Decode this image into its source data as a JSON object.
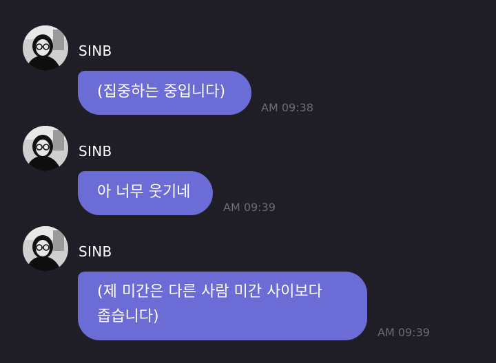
{
  "messages": [
    {
      "sender": "SINB",
      "text": "(집중하는 중입니다)",
      "time": "AM 09:38"
    },
    {
      "sender": "SINB",
      "text": "아 너무 웃기네",
      "time": "AM 09:39"
    },
    {
      "sender": "SINB",
      "text_line1": "(제 미간은 다른 사람 미간 사이보다",
      "text_line2": "좁습니다)",
      "time": "AM 09:39"
    }
  ],
  "colors": {
    "background": "#1f1e26",
    "bubble": "#6b6cd6",
    "timestamp": "#6c6b78"
  },
  "icons": {
    "avatar": "profile-photo-icon"
  }
}
